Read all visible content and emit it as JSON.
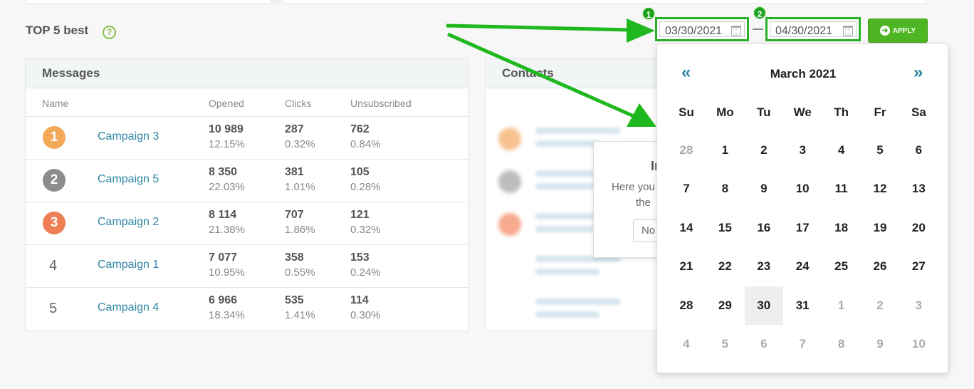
{
  "section": {
    "title": "TOP 5 best",
    "help_glyph": "?"
  },
  "date_range": {
    "from": "03/30/2021",
    "to": "04/30/2021",
    "from_step": "1",
    "to_step": "2",
    "apply_label": "APPLY"
  },
  "messages": {
    "title": "Messages",
    "columns": {
      "name": "Name",
      "opened": "Opened",
      "clicks": "Clicks",
      "unsubscribed": "Unsubscribed"
    },
    "rows": [
      {
        "rank": "1",
        "name": "Campaign 3",
        "opened": "10 989",
        "opened_pct": "12.15%",
        "clicks": "287",
        "clicks_pct": "0.32%",
        "unsub": "762",
        "unsub_pct": "0.84%",
        "badge_color": "#f2a95a"
      },
      {
        "rank": "2",
        "name": "Campaign 5",
        "opened": "8 350",
        "opened_pct": "22.03%",
        "clicks": "381",
        "clicks_pct": "1.01%",
        "unsub": "105",
        "unsub_pct": "0.28%",
        "badge_color": "#8c8c8c"
      },
      {
        "rank": "3",
        "name": "Campaign 2",
        "opened": "8 114",
        "opened_pct": "21.38%",
        "clicks": "707",
        "clicks_pct": "1.86%",
        "unsub": "121",
        "unsub_pct": "0.32%",
        "badge_color": "#ee7f55"
      },
      {
        "rank": "4",
        "name": "Campaign 1",
        "opened": "7 077",
        "opened_pct": "10.95%",
        "clicks": "358",
        "clicks_pct": "0.55%",
        "unsub": "153",
        "unsub_pct": "0.24%",
        "badge_color": ""
      },
      {
        "rank": "5",
        "name": "Campaign 4",
        "opened": "6 966",
        "opened_pct": "18.34%",
        "clicks": "535",
        "clicks_pct": "1.41%",
        "unsub": "114",
        "unsub_pct": "0.30%",
        "badge_color": ""
      }
    ]
  },
  "contacts": {
    "title": "Contacts",
    "popup": {
      "title": "In",
      "text1": "Here you",
      "text2": "the",
      "button": "No"
    }
  },
  "calendar": {
    "prev": "«",
    "next": "»",
    "month_label": "March 2021",
    "weekdays": [
      "Su",
      "Mo",
      "Tu",
      "We",
      "Th",
      "Fr",
      "Sa"
    ],
    "weeks": [
      [
        "28",
        "1",
        "2",
        "3",
        "4",
        "5",
        "6"
      ],
      [
        "7",
        "8",
        "9",
        "10",
        "11",
        "12",
        "13"
      ],
      [
        "14",
        "15",
        "16",
        "17",
        "18",
        "19",
        "20"
      ],
      [
        "21",
        "22",
        "23",
        "24",
        "25",
        "26",
        "27"
      ],
      [
        "28",
        "29",
        "30",
        "31",
        "1",
        "2",
        "3"
      ],
      [
        "4",
        "5",
        "6",
        "7",
        "8",
        "9",
        "10"
      ]
    ],
    "selected": "30"
  },
  "colors": {
    "accent_green": "#28b028",
    "link_blue": "#2f86a6",
    "apply_green": "#4eb623"
  }
}
